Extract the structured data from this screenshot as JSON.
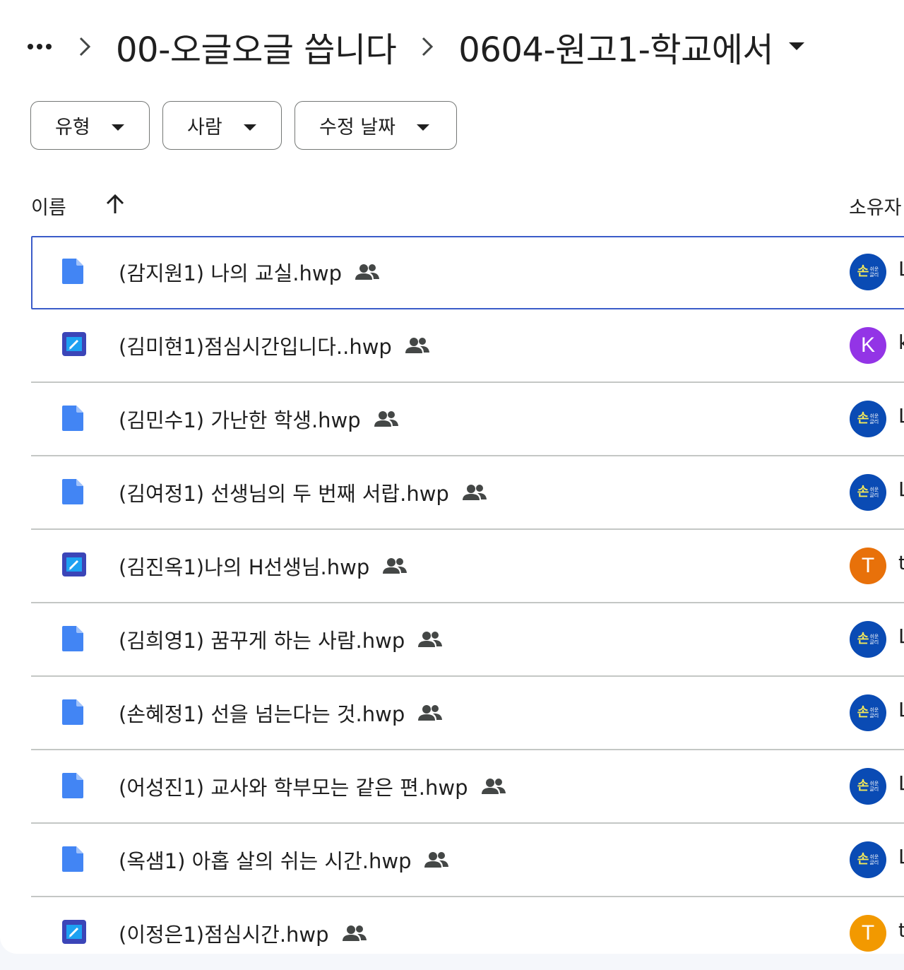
{
  "breadcrumb": {
    "more_icon": "more-horiz-icon",
    "items": [
      "00-오글오글 씁니다",
      "0604-원고1-학교에서"
    ]
  },
  "filters": [
    {
      "label": "유형"
    },
    {
      "label": "사람"
    },
    {
      "label": "수정 날짜"
    }
  ],
  "columns": {
    "name": "이름",
    "sort": "ascending",
    "owner": "소유자"
  },
  "colors": {
    "doc_icon": "#4285f4",
    "hancom_icon": "#3b45b8",
    "selected_border": "#3b5cc9",
    "logo_bg": "#0a4bb4",
    "logo_text": "#f3e85a"
  },
  "files": [
    {
      "name": "(감지원1) 나의 교실.hwp",
      "icon": "doc-icon",
      "shared": true,
      "owner_avatar": "logo",
      "owner_text": "L",
      "selected": true
    },
    {
      "name": "(김미현1)점심시간입니다..hwp",
      "icon": "hancom-icon",
      "shared": true,
      "owner_avatar": "K",
      "avatar_color": "#9334e6",
      "owner_text": "k"
    },
    {
      "name": "(김민수1) 가난한 학생.hwp",
      "icon": "doc-icon",
      "shared": true,
      "owner_avatar": "logo",
      "owner_text": "L"
    },
    {
      "name": "(김여정1) 선생님의 두 번째 서랍.hwp",
      "icon": "doc-icon",
      "shared": true,
      "owner_avatar": "logo",
      "owner_text": "L"
    },
    {
      "name": "(김진옥1)나의 H선생님.hwp",
      "icon": "hancom-icon",
      "shared": true,
      "owner_avatar": "T",
      "avatar_color": "#e8710a",
      "owner_text": "t"
    },
    {
      "name": "(김희영1) 꿈꾸게 하는 사람.hwp",
      "icon": "doc-icon",
      "shared": true,
      "owner_avatar": "logo",
      "owner_text": "L"
    },
    {
      "name": "(손혜정1) 선을 넘는다는 것.hwp",
      "icon": "doc-icon",
      "shared": true,
      "owner_avatar": "logo",
      "owner_text": "L"
    },
    {
      "name": "(어성진1) 교사와 학부모는 같은 편.hwp",
      "icon": "doc-icon",
      "shared": true,
      "owner_avatar": "logo",
      "owner_text": "L"
    },
    {
      "name": "(옥샘1) 아홉 살의 쉬는 시간.hwp",
      "icon": "doc-icon",
      "shared": true,
      "owner_avatar": "logo",
      "owner_text": "L"
    },
    {
      "name": "(이정은1)점심시간.hwp",
      "icon": "hancom-icon",
      "shared": true,
      "owner_avatar": "T",
      "avatar_color": "#f29900",
      "owner_text": "t"
    }
  ],
  "logo_avatar": {
    "big": "손",
    "small_top": "쉬운",
    "small_bottom": "글리"
  }
}
